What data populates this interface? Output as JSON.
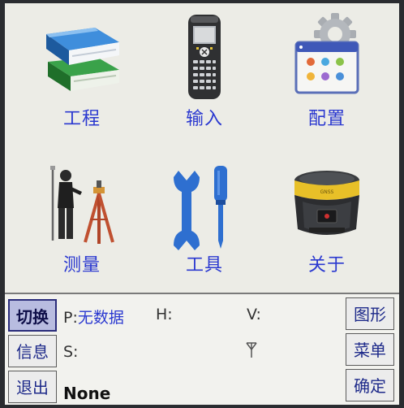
{
  "menu": {
    "items": [
      {
        "label": "工程",
        "icon": "books-icon"
      },
      {
        "label": "输入",
        "icon": "handheld-controller-icon"
      },
      {
        "label": "配置",
        "icon": "settings-window-gear-icon"
      },
      {
        "label": "测量",
        "icon": "surveyor-tripod-icon"
      },
      {
        "label": "工具",
        "icon": "wrench-screwdriver-icon"
      },
      {
        "label": "关于",
        "icon": "gnss-receiver-icon"
      }
    ]
  },
  "status": {
    "left_buttons": {
      "switch": "切换",
      "info": "信息",
      "exit": "退出"
    },
    "right_buttons": {
      "graph": "图形",
      "menu": "菜单",
      "ok": "确定"
    },
    "p_label": "P:",
    "p_value": "无数据",
    "h_label": "H:",
    "v_label": "V:",
    "s_label": "S:",
    "source": "None"
  },
  "colors": {
    "label_blue": "#2a38d0",
    "screen_bg": "#ecece6",
    "active_button": "#b8bce0"
  }
}
